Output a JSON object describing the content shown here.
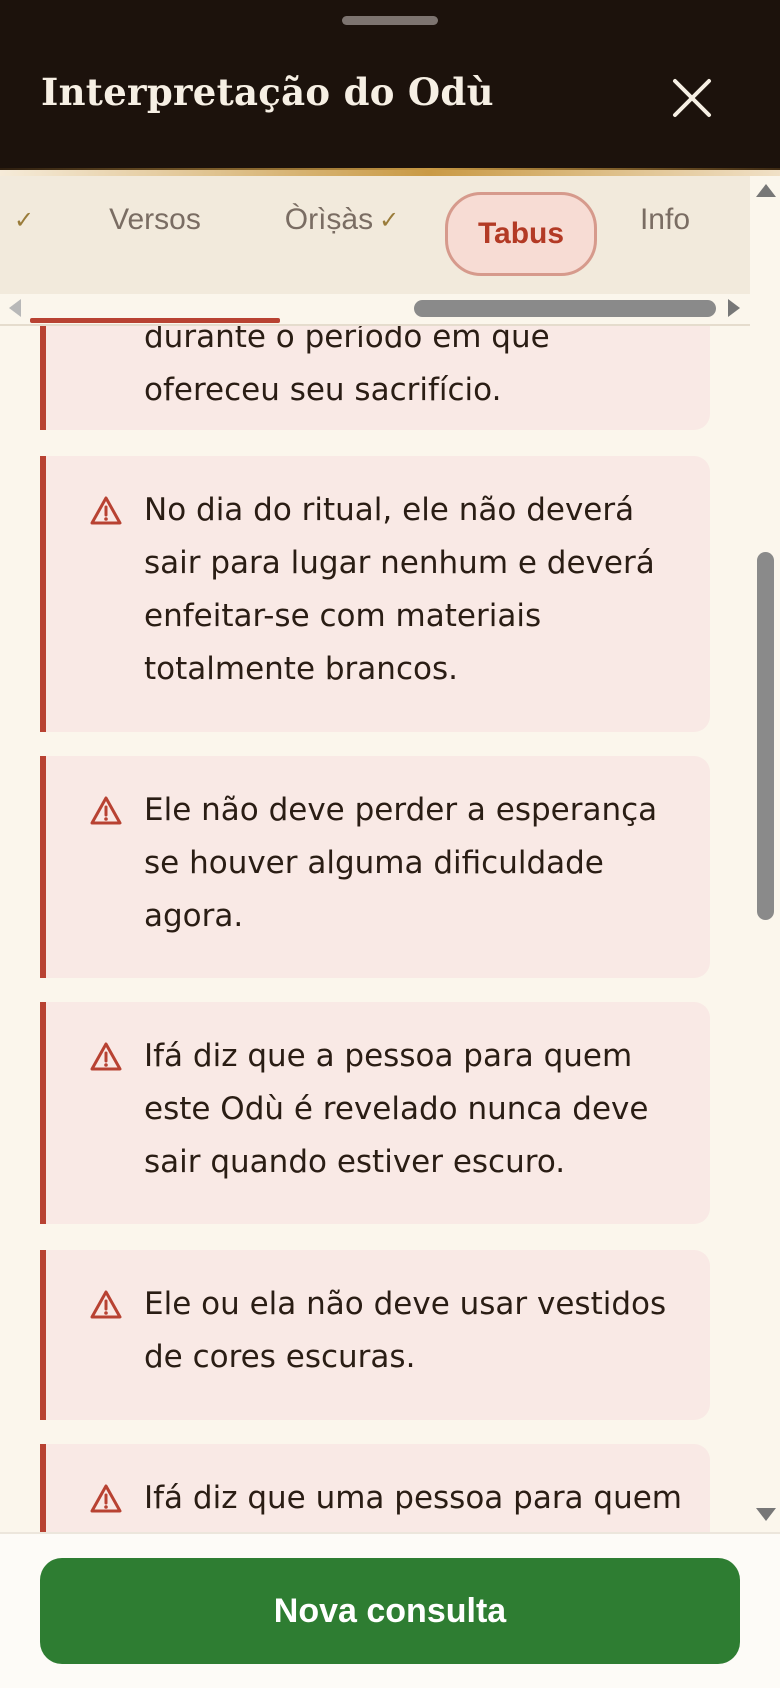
{
  "header": {
    "title": "Interpretação do Odù",
    "close_icon": "close-icon"
  },
  "tabs": [
    {
      "label": "",
      "checked": true
    },
    {
      "label": "Versos",
      "checked": false
    },
    {
      "label": "Òrìṣàs",
      "checked": true
    },
    {
      "label": "Tabus",
      "checked": false,
      "active": true
    },
    {
      "label": "Info",
      "checked": false
    }
  ],
  "check_glyph": "✓",
  "cards": [
    {
      "text": "durante o período em que ofereceu seu sacrifício.",
      "icon": "warning-icon"
    },
    {
      "text": "No dia do ritual, ele não deverá sair para lugar nenhum e deverá enfeitar-se com materiais totalmente brancos.",
      "icon": "warning-icon"
    },
    {
      "text": "Ele não deve perder a esperança se houver alguma dificuldade agora.",
      "icon": "warning-icon"
    },
    {
      "text": "Ifá diz que a pessoa para quem este Odù é revelado nunca deve sair quando estiver escuro.",
      "icon": "warning-icon"
    },
    {
      "text": "Ele ou ela não deve usar vestidos de cores escuras.",
      "icon": "warning-icon"
    },
    {
      "text": "Ifá diz que uma pessoa para quem",
      "icon": "warning-icon"
    }
  ],
  "footer": {
    "button_label": "Nova consulta"
  },
  "colors": {
    "header_bg": "#1c120c",
    "accent_red": "#b84232",
    "card_bg": "#f9e9e5",
    "button_green": "#2e7d32",
    "page_bg": "#fbf6ec"
  }
}
